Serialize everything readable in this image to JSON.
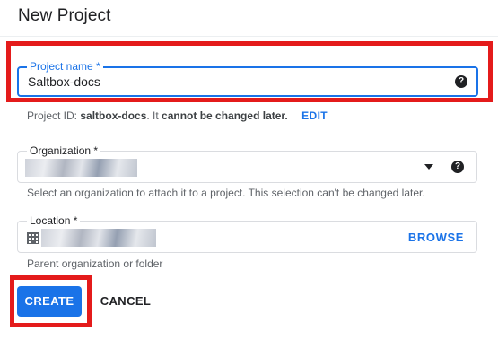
{
  "dialog": {
    "title": "New Project"
  },
  "project_name": {
    "label": "Project name *",
    "value": "Saltbox-docs",
    "help_icon": "help-icon"
  },
  "project_id_hint": {
    "prefix": "Project ID: ",
    "id": "saltbox-docs",
    "suffix": ". It ",
    "emphasis": "cannot be changed later.",
    "edit_label": "EDIT"
  },
  "organization": {
    "label": "Organization *",
    "selected_value": "",
    "dropdown_icon": "chevron-down-icon",
    "help_icon": "help-icon",
    "hint": "Select an organization to attach it to a project. This selection can't be changed later."
  },
  "location": {
    "label": "Location *",
    "value": "",
    "icon": "building-icon",
    "browse_label": "BROWSE",
    "hint": "Parent organization or folder"
  },
  "actions": {
    "create_label": "CREATE",
    "cancel_label": "CANCEL"
  },
  "colors": {
    "accent": "#1a73e8",
    "highlight": "#e41b1b"
  }
}
